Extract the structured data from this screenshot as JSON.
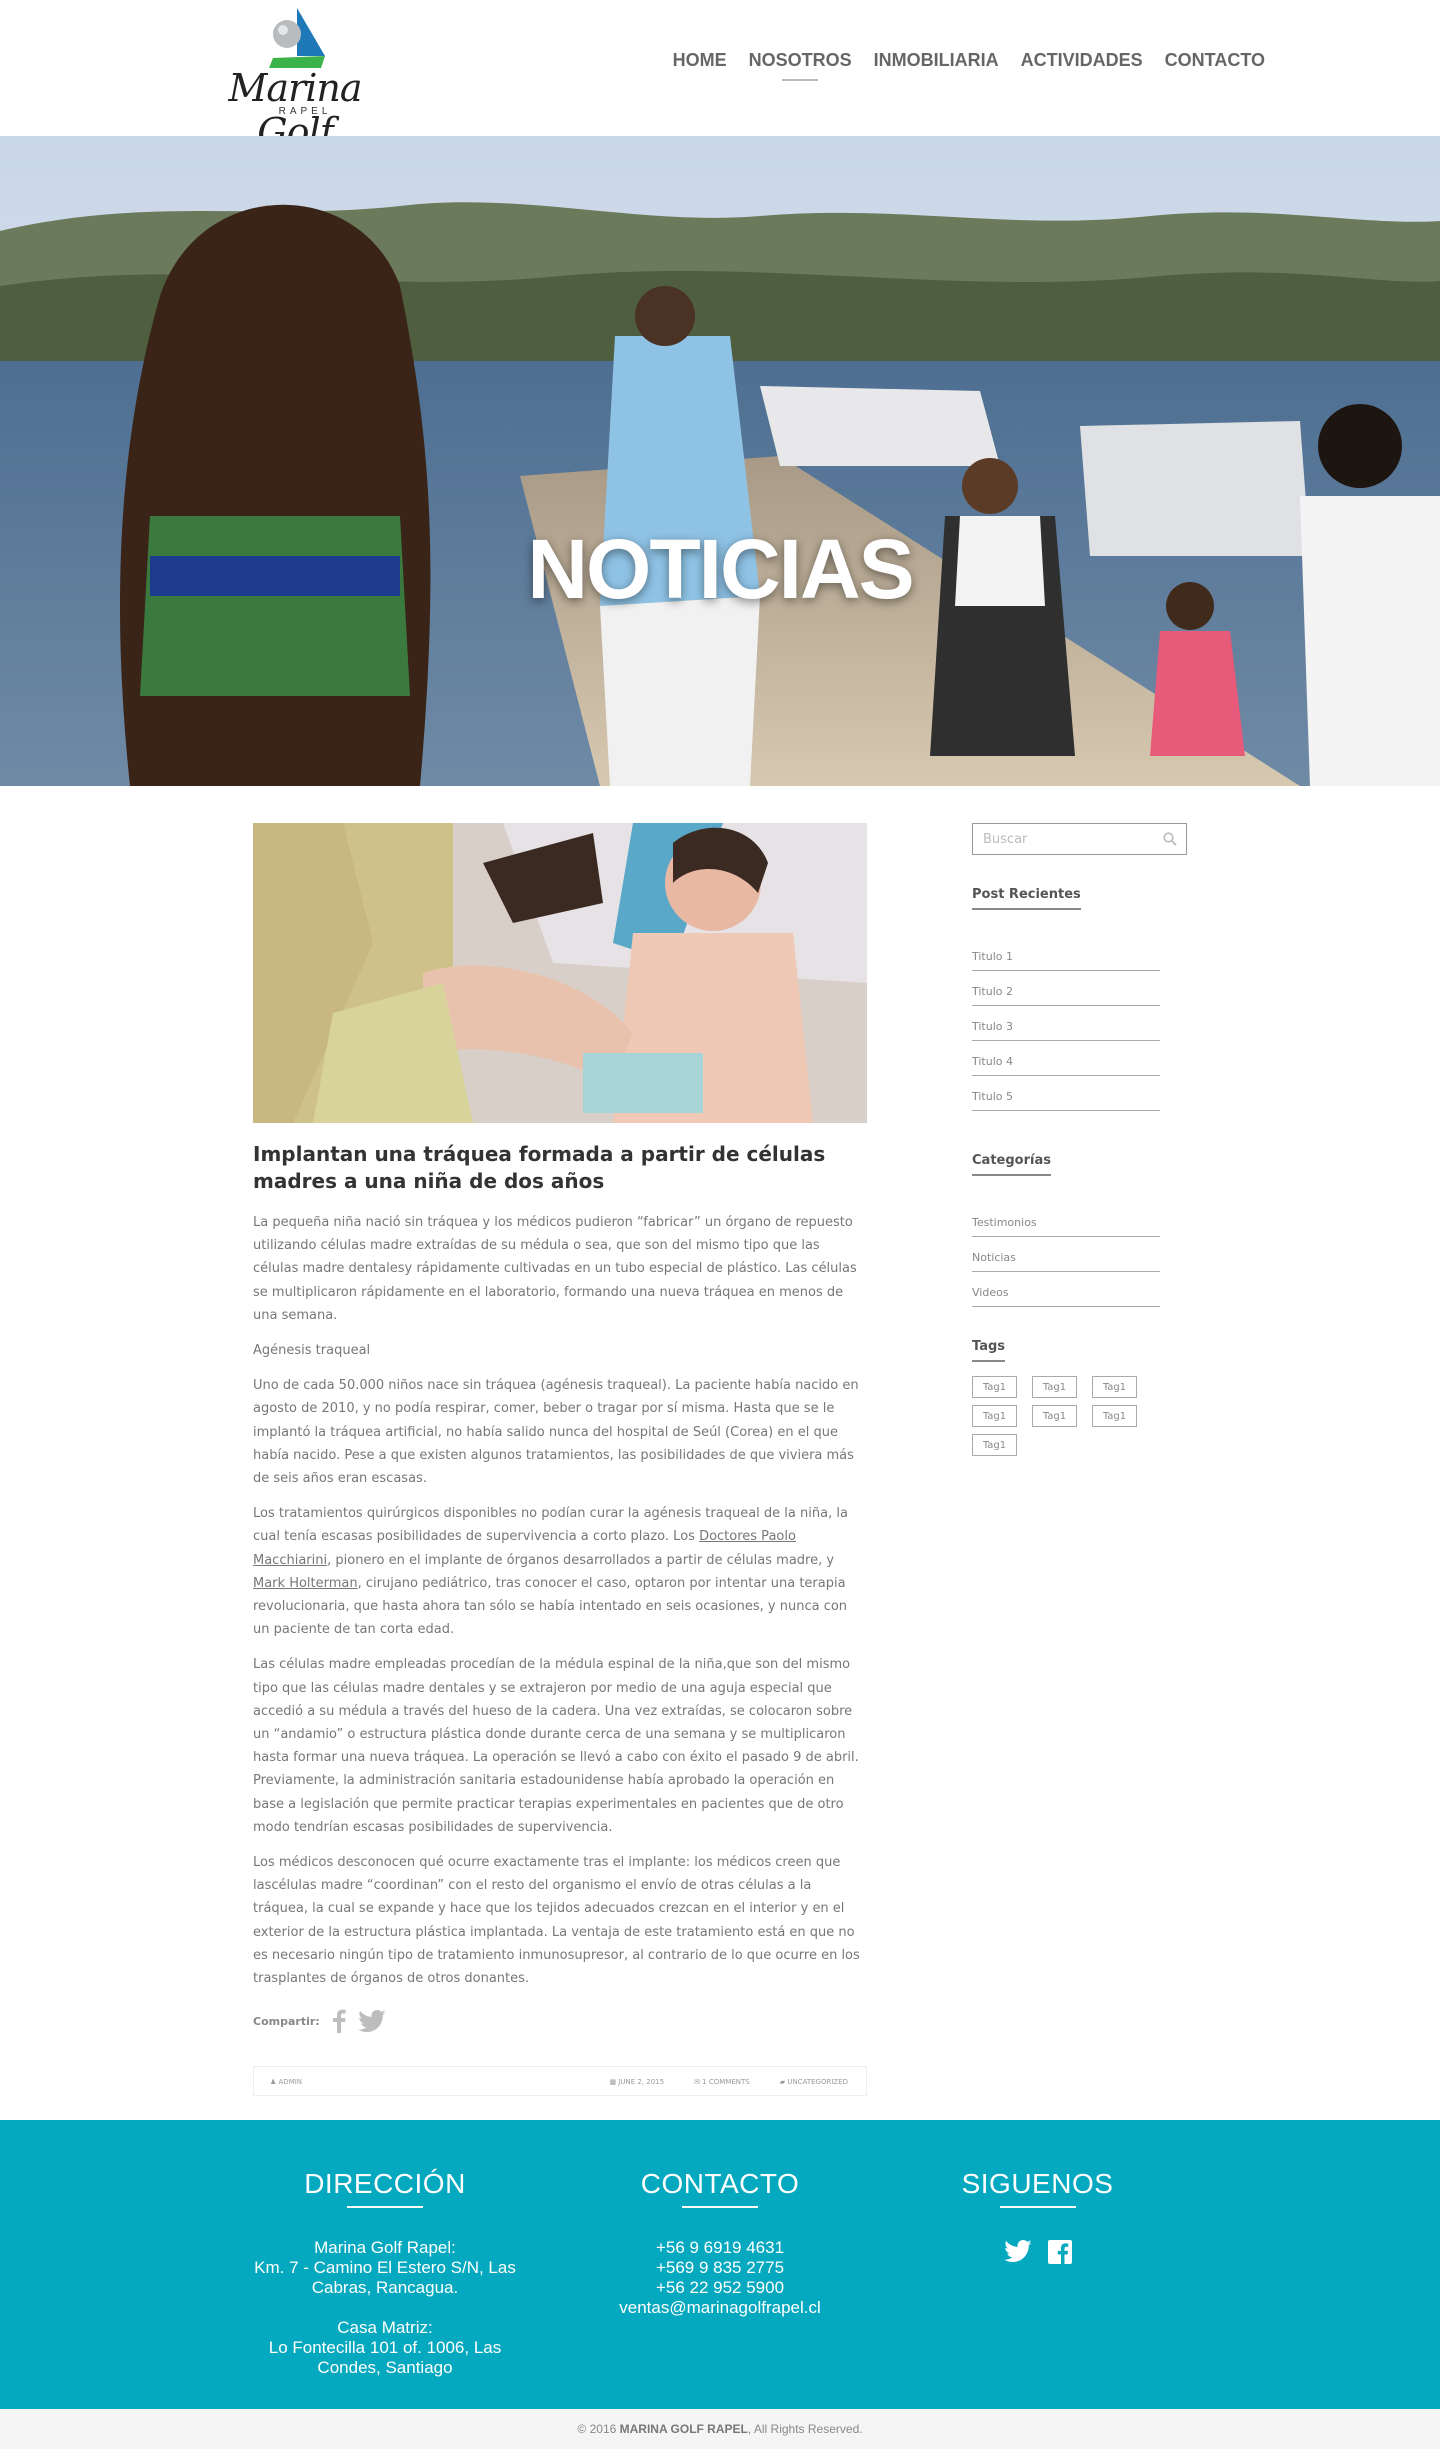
{
  "brand": {
    "logo_text": "Marina Golf",
    "logo_sub": "RAPEL",
    "colors": {
      "teal": "#04a8bf",
      "nav_text": "#666666",
      "logo_blue": "#1f78b8",
      "logo_green": "#3cb34a"
    }
  },
  "nav": {
    "items": [
      {
        "label": "HOME"
      },
      {
        "label": "NOSOTROS",
        "active": true
      },
      {
        "label": "INMOBILIARIA"
      },
      {
        "label": "ACTIVIDADES"
      },
      {
        "label": "CONTACTO"
      }
    ]
  },
  "hero": {
    "title": "NOTICIAS"
  },
  "article": {
    "title": "Implantan una tráquea formada a partir de células madres a una niña de dos años",
    "p1": "La pequeña niña nació sin tráquea y los médicos pudieron “fabricar” un órgano de repuesto utilizando células madre extraídas de su médula o sea, que son del mismo tipo que las células madre dentalesy rápidamente cultivadas en un tubo especial de plástico. Las células se multiplicaron rápidamente en el laboratorio, formando una nueva tráquea en menos de una semana.",
    "p2": "Agénesis traqueal",
    "p3": "Uno de cada 50.000 niños nace sin tráquea (agénesis traqueal). La paciente había nacido en agosto de 2010, y no podía respirar, comer, beber o tragar por sí misma. Hasta que se le implantó la tráquea artificial, no había salido nunca del hospital de Seúl (Corea) en el que había nacido. Pese a que existen algunos tratamientos, las posibilidades de que viviera más de seis años eran escasas.",
    "p4_a": "Los tratamientos quirúrgicos disponibles no podían curar la agénesis traqueal de la niña, la cual tenía escasas posibilidades de supervivencia a corto plazo. Los ",
    "p4_link1": "Doctores Paolo Macchiarini",
    "p4_b": ", pionero en el implante de órganos desarrollados a partir de células madre, y ",
    "p4_link2": "Mark Holterman",
    "p4_c": ", cirujano pediátrico, tras conocer el caso, optaron por intentar una terapia revolucionaria, que hasta ahora tan sólo se había intentado en seis ocasiones, y nunca con un paciente de tan corta edad.",
    "p5": "Las células madre empleadas procedían de la médula espinal de la niña,que son del mismo tipo que las células madre dentales y se extrajeron por medio de una aguja especial que accedió a su médula a través del hueso de la cadera. Una vez extraídas, se colocaron sobre un “andamio” o estructura plástica donde durante cerca de una semana y se multiplicaron hasta formar una nueva tráquea. La operación se llevó a cabo con éxito el pasado 9 de abril. Previamente, la administración sanitaria estadounidense había aprobado la operación en base a legislación que permite practicar terapias experimentales en pacientes que de otro modo tendrían escasas posibilidades de supervivencia.",
    "p6": "Los médicos desconocen qué ocurre exactamente tras el implante: los médicos creen que lascélulas madre “coordinan” con el resto del organismo el envío de otras células a la tráquea, la cual se expande y hace que los tejidos adecuados crezcan en el interior y en el exterior de la estructura plástica implantada. La ventaja de este tratamiento está en que no es necesario ningún tipo de tratamiento inmunosupresor, al contrario de lo que ocurre en los trasplantes de órganos de otros donantes.",
    "share_label": "Compartir:",
    "meta": {
      "author": "ADMIN",
      "date": "JUNE 2, 2015",
      "comments": "1 COMMENTS",
      "category": "UNCATEGORIZED"
    }
  },
  "sidebar": {
    "search_placeholder": "Buscar",
    "recent_title": "Post Recientes",
    "recent": [
      "Titulo 1",
      "Titulo 2",
      "Titulo 3",
      "Titulo 4",
      "Titulo 5"
    ],
    "categories_title": "Categorías",
    "categories": [
      "Testimonios",
      "Noticias",
      "Videos"
    ],
    "tags_title": "Tags",
    "tags": [
      "Tag1",
      "Tag1",
      "Tag1",
      "Tag1",
      "Tag1",
      "Tag1",
      "Tag1"
    ]
  },
  "footer": {
    "direccion_title": "DIRECCIÓN",
    "direccion_lines": [
      "Marina Golf Rapel:",
      "Km. 7 - Camino El Estero S/N, Las",
      "Cabras, Rancagua.",
      "",
      "Casa Matriz:",
      "Lo Fontecilla 101 of. 1006, Las",
      "Condes, Santiago"
    ],
    "contacto_title": "CONTACTO",
    "contacto_lines": [
      "+56 9 6919 4631",
      "+569 9 835 2775",
      "+56 22 952 5900",
      "ventas@marinagolfrapel.cl"
    ],
    "siguenos_title": "SIGUENOS",
    "social_icons": [
      "twitter-icon",
      "facebook-icon"
    ]
  },
  "copyright": {
    "prefix": "© 2016 ",
    "brand": "MARINA GOLF RAPEL",
    "suffix": ", All Rights Reserved."
  }
}
